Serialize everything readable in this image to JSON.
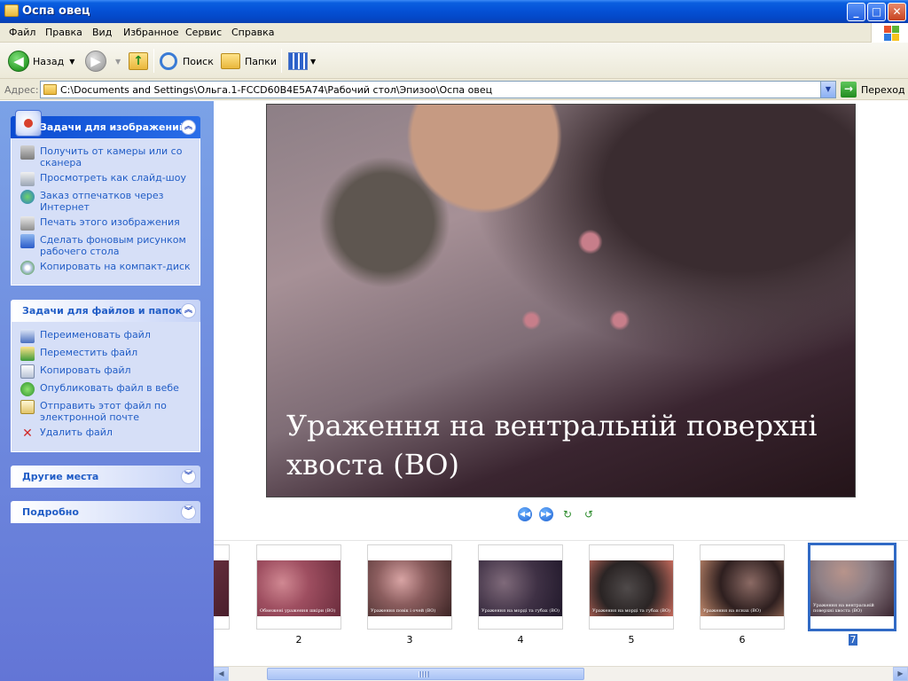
{
  "window": {
    "title": "Оспа овец",
    "controls": {
      "minimize": "_",
      "maximize": "□",
      "close": "✕"
    }
  },
  "menu": [
    "Файл",
    "Правка",
    "Вид",
    "Избранное",
    "Сервис",
    "Справка"
  ],
  "toolbar": {
    "back": "Назад",
    "search": "Поиск",
    "folders": "Папки"
  },
  "address": {
    "label": "Адрес:",
    "path": "C:\\Documents and Settings\\Ольга.1-FCCD60B4E5A74\\Рабочий стол\\Эпизоо\\Оспа овец",
    "go": "Переход"
  },
  "left_pane": {
    "image_tasks": {
      "title": "Задачи для изображений",
      "items": [
        {
          "label": "Получить от камеры или со сканера",
          "icon": "camera-icon"
        },
        {
          "label": "Просмотреть как слайд-шоу",
          "icon": "slideshow-icon"
        },
        {
          "label": "Заказ отпечатков через Интернет",
          "icon": "globe-icon"
        },
        {
          "label": "Печать этого изображения",
          "icon": "printer-icon"
        },
        {
          "label": "Сделать фоновым рисунком рабочего стола",
          "icon": "desktop-icon"
        },
        {
          "label": "Копировать на компакт-диск",
          "icon": "cd-icon"
        }
      ]
    },
    "file_tasks": {
      "title": "Задачи для файлов и папок",
      "items": [
        {
          "label": "Переименовать файл",
          "icon": "rename-icon"
        },
        {
          "label": "Переместить файл",
          "icon": "move-icon"
        },
        {
          "label": "Копировать файл",
          "icon": "copy-icon"
        },
        {
          "label": "Опубликовать файл в вебе",
          "icon": "web-publish-icon"
        },
        {
          "label": "Отправить этот файл по электронной почте",
          "icon": "email-icon"
        },
        {
          "label": "Удалить файл",
          "icon": "delete-icon"
        }
      ]
    },
    "other_places": {
      "title": "Другие места"
    },
    "details": {
      "title": "Подробно"
    }
  },
  "preview": {
    "caption_line1": "Ураження на вентральній поверхні",
    "caption_line2": "хвоста (ВО)"
  },
  "filmstrip": {
    "thumbs": [
      {
        "number": "",
        "caption": ""
      },
      {
        "number": "2",
        "caption": "Обмежені ураження шкіри (ВО)"
      },
      {
        "number": "3",
        "caption": "Ураження повік і очей (ВО)"
      },
      {
        "number": "4",
        "caption": "Ураження на морді та губах (ВО)"
      },
      {
        "number": "5",
        "caption": "Ураження на морді та губах (ВО)"
      },
      {
        "number": "6",
        "caption": "Ураження на яснах (ВО)"
      },
      {
        "number": "7",
        "caption": "Ураження на вентральній поверхні хвоста (ВО)"
      }
    ],
    "selected": "7"
  },
  "colors": {
    "titlebar": "#0553d8",
    "leftpane": "#6f8de0",
    "selection": "#316ac5",
    "link": "#215dc6"
  }
}
